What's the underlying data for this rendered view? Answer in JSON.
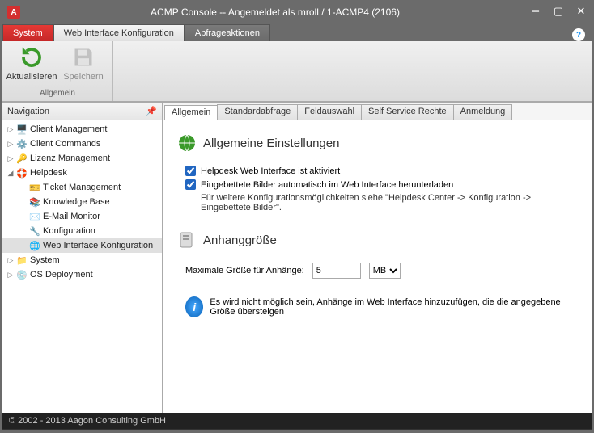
{
  "window": {
    "title": "ACMP Console  --  Angemeldet als mroll / 1-ACMP4 (2106)",
    "app_icon_letter": "A"
  },
  "top_tabs": {
    "system": "System",
    "web_interface": "Web Interface Konfiguration",
    "abfrageaktionen": "Abfrageaktionen"
  },
  "ribbon": {
    "aktualisieren": "Aktualisieren",
    "speichern": "Speichern",
    "group_label": "Allgemein"
  },
  "nav": {
    "header": "Navigation",
    "items": {
      "client_management": "Client Management",
      "client_commands": "Client Commands",
      "lizenz_management": "Lizenz Management",
      "helpdesk": "Helpdesk",
      "ticket_management": "Ticket Management",
      "knowledge_base": "Knowledge Base",
      "email_monitor": "E-Mail Monitor",
      "konfiguration": "Konfiguration",
      "web_interface_konfiguration": "Web Interface Konfiguration",
      "system": "System",
      "os_deployment": "OS Deployment"
    }
  },
  "subtabs": {
    "allgemein": "Allgemein",
    "standardabfrage": "Standardabfrage",
    "feldauswahl": "Feldauswahl",
    "self_service": "Self Service Rechte",
    "anmeldung": "Anmeldung"
  },
  "content": {
    "section1_title": "Allgemeine Einstellungen",
    "chk1_label": "Helpdesk Web Interface ist aktiviert",
    "chk1_checked": true,
    "chk2_label": "Eingebettete Bilder automatisch im Web Interface herunterladen",
    "chk2_checked": true,
    "hint1": "Für weitere Konfigurationsmöglichkeiten siehe \"Helpdesk Center -> Konfiguration -> Eingebettete Bilder\".",
    "section2_title": "Anhanggröße",
    "max_size_label": "Maximale Größe für Anhänge:",
    "max_size_value": "5",
    "max_size_unit": "MB",
    "info_text": "Es wird nicht möglich sein, Anhänge im Web Interface hinzuzufügen, die die angegebene Größe übersteigen"
  },
  "statusbar": "© 2002 - 2013 Aagon Consulting GmbH"
}
